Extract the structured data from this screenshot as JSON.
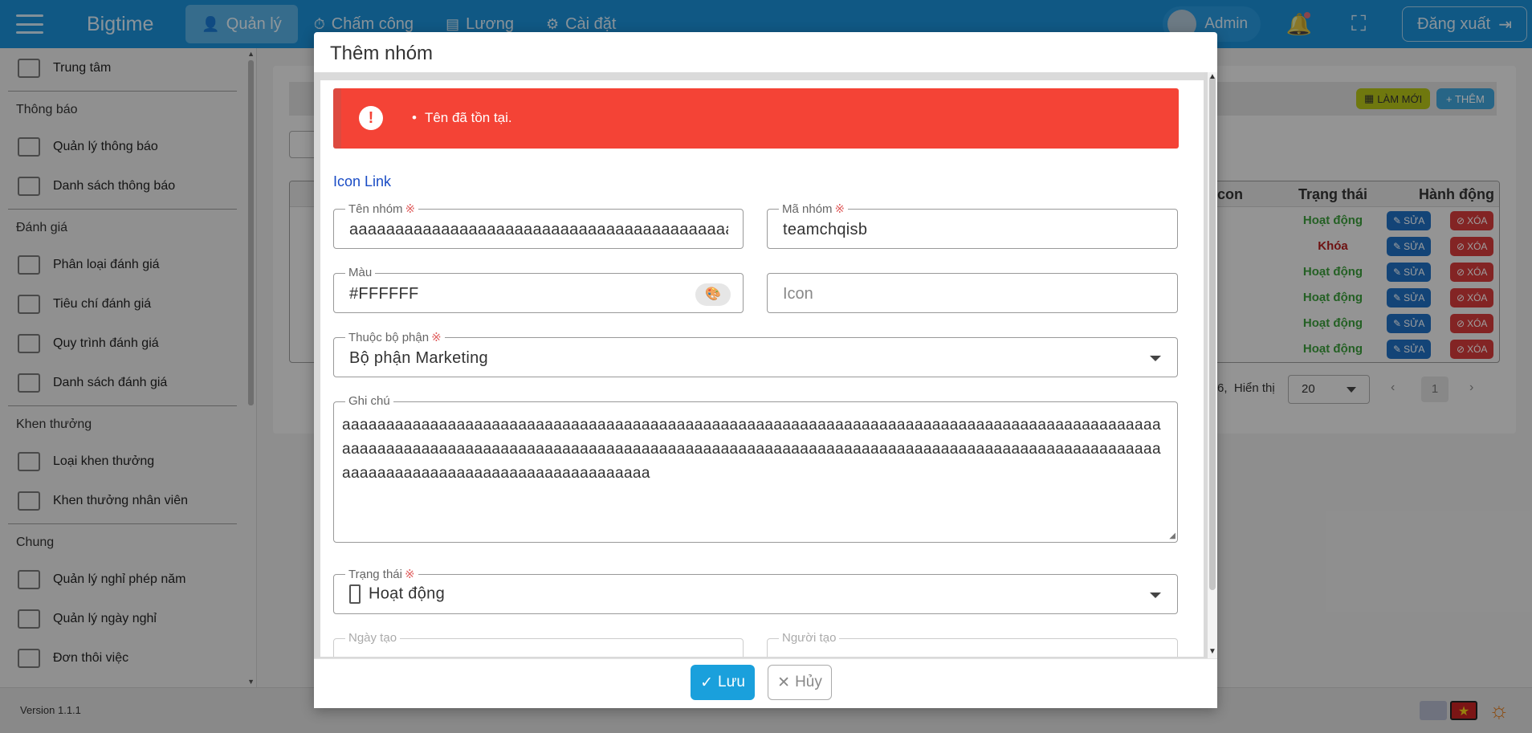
{
  "topbar": {
    "brand": "Bigtime",
    "nav": [
      {
        "label": "Quản lý",
        "icon": "user-icon",
        "active": true
      },
      {
        "label": "Chấm công",
        "icon": "timer-icon",
        "active": false
      },
      {
        "label": "Lương",
        "icon": "book-icon",
        "active": false
      },
      {
        "label": "Cài đặt",
        "icon": "gear-icon",
        "active": false
      }
    ],
    "user": "Admin",
    "logout": "Đăng xuất"
  },
  "sidebar": {
    "top_item": "Trung tâm",
    "groups": [
      {
        "title": "Thông báo",
        "items": [
          "Quản lý thông báo",
          "Danh sách thông báo"
        ]
      },
      {
        "title": "Đánh giá",
        "items": [
          "Phân loại đánh giá",
          "Tiêu chí đánh giá",
          "Quy trình đánh giá",
          "Danh sách đánh giá"
        ]
      },
      {
        "title": "Khen thưởng",
        "items": [
          "Loại khen thưởng",
          "Khen thưởng nhân viên"
        ]
      },
      {
        "title": "Chung",
        "items": [
          "Quản lý nghỉ phép năm",
          "Quản lý ngày nghỉ",
          "Đơn thôi việc"
        ]
      }
    ]
  },
  "background": {
    "btn_lammoi": "LÀM MỚI",
    "btn_them": "+ THÊM",
    "columns": {
      "icon": "Icon",
      "status": "Trạng thái",
      "actions": "Hành động"
    },
    "rows": [
      {
        "status": "Hoạt động",
        "active": true
      },
      {
        "status": "Khóa",
        "active": false
      },
      {
        "status": "Hoạt động",
        "active": true
      },
      {
        "status": "Hoạt động",
        "active": true
      },
      {
        "status": "Hoạt động",
        "active": true
      },
      {
        "status": "Hoạt động",
        "active": true
      }
    ],
    "row_edit": "SỬA",
    "row_delete": "XÓA",
    "pager": {
      "total_suffix": "6,",
      "show_label": "Hiển thị",
      "page_size": "20",
      "current_page": "1"
    }
  },
  "modal": {
    "title": "Thêm nhóm",
    "error": "Tên đã tồn tại.",
    "icon_link": "Icon Link",
    "fields": {
      "ten_nhom": {
        "label": "Tên nhóm",
        "value": "aaaaaaaaaaaaaaaaaaaaaaaaaaaaaaaaaaaaaaaaaaaaa"
      },
      "ma_nhom": {
        "label": "Mã nhóm",
        "value": "teamchqisb"
      },
      "mau": {
        "label": "Màu",
        "value": "#FFFFFF"
      },
      "icon": {
        "placeholder": "Icon"
      },
      "bo_phan": {
        "label": "Thuộc bộ phận",
        "value": "Bộ phận Marketing"
      },
      "ghi_chu": {
        "label": "Ghi chú",
        "value": "aaaaaaaaaaaaaaaaaaaaaaaaaaaaaaaaaaaaaaaaaaaaaaaaaaaaaaaaaaaaaaaaaaaaaaaaaaaaaaaaaaaaaaaaaaaaaaaaaaaaaaaaaaaaaaaaaaaaaaaaaaaaaaaaaaaaaaaaaaaaaaaaaaaaaaaaaaaaaaaaaaaaaaaaaaaaaaaaaaaaaaaaaaaaaaaaaaaaaaaaaaaaaaaaaaaaaaaaaaaaa"
      },
      "trang_thai": {
        "label": "Trạng thái",
        "value": "Hoạt động"
      },
      "ngay_tao": {
        "label": "Ngày tạo"
      },
      "nguoi_tao": {
        "label": "Người tạo"
      }
    },
    "required_mark": "※",
    "save": "Lưu",
    "cancel": "Hủy"
  },
  "footer": {
    "version": "Version 1.1.1"
  }
}
